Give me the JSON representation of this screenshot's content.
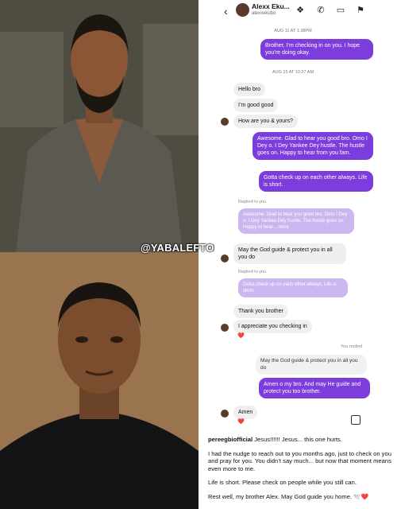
{
  "watermark": "@YABALEFTONLINE",
  "header": {
    "name": "Alexx Eku...",
    "handle": "alexxekubo"
  },
  "timestamps": [
    "AUG 11 AT 1:38PM",
    "AUG 15 AT 10:27 AM"
  ],
  "messages": {
    "m1": "Brother, I’m checking in on you. I hope you’re doing okay.",
    "m2": "Hello bro",
    "m3": "I’m good good",
    "m4": "How are you & yours?",
    "m5": "Awesome. Glad to hear you good bro. Omo I Dey o. I Dey Yankee Dey hustle. The hustle goes on. Happy to hear from you fam.",
    "m6": "Gotta check up on each other always. Life is short.",
    "replied_to_you_1": "Replied to you",
    "reply1": "Awesome. Glad to hear you good bro. Omo I Dey o. I Dey Yankee Dey hustle. The hustle goes on. Happy to hear... more",
    "m7": "May the God guide & protect you in all you do",
    "replied_to_you_2": "Replied to you",
    "reply2": "Gotta check up on each other always. Life is short.",
    "m8": "Thank you brother",
    "m9": "I appreciate you checking in",
    "you_replied": "You replied",
    "reply3": "May the God guide & protect you in all you do",
    "m10": "Amen o my bro. And may He guide and protect you too brother.",
    "m11": "Amen",
    "heart": "❤️"
  },
  "caption": {
    "username": "pereegbiofficial",
    "line1": "Jesus!!!!!! Jesus... this one hurts.",
    "p2": "I had the nudge to reach out to you months ago, just to check on you and pray for you. You didn’t say much... but now that moment means even more to me.",
    "p3": "Life is short. Please check on people while you still can.",
    "p4": "Rest well, my brother Alex. May God guide you home. 🕊️❤️"
  }
}
